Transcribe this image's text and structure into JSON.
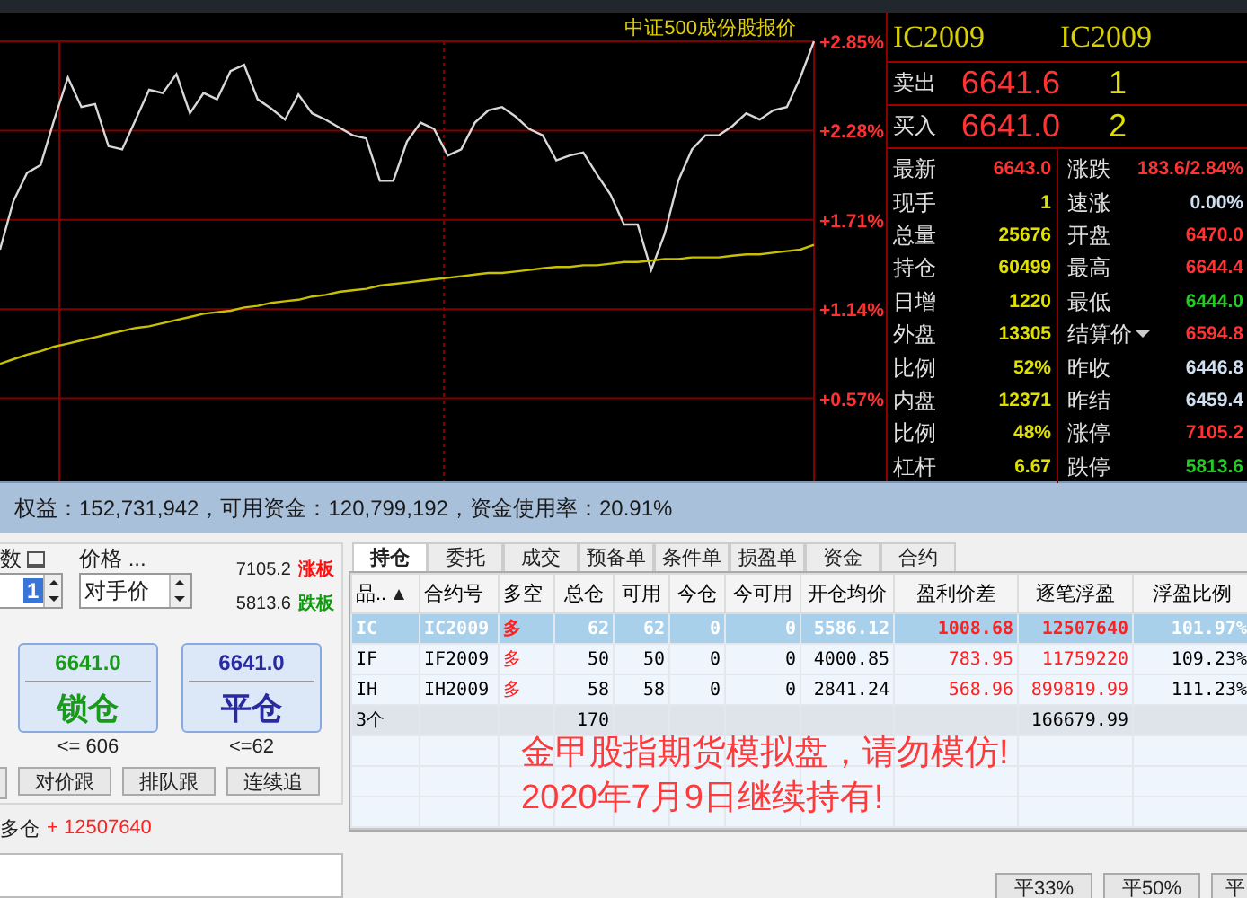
{
  "chart_panel": {
    "chart_data": {
      "type": "line",
      "title": "中证500成份股报价",
      "grid": true,
      "ylim": [
        0.04,
        2.85
      ],
      "yticks": [
        {
          "value": 0.57,
          "label": "+0.57%"
        },
        {
          "value": 1.14,
          "label": "+1.14%"
        },
        {
          "value": 1.71,
          "label": "+1.71%"
        },
        {
          "value": 2.28,
          "label": "+2.28%"
        },
        {
          "value": 2.85,
          "label": "+2.85%"
        }
      ],
      "series": [
        {
          "color": "#d8d8d8",
          "values": [
            1.52,
            1.83,
            2.01,
            2.06,
            2.35,
            2.62,
            2.43,
            2.45,
            2.18,
            2.16,
            2.35,
            2.54,
            2.52,
            2.64,
            2.39,
            2.52,
            2.48,
            2.66,
            2.7,
            2.48,
            2.42,
            2.35,
            2.51,
            2.39,
            2.35,
            2.3,
            2.25,
            2.23,
            1.96,
            1.96,
            2.21,
            2.33,
            2.29,
            2.12,
            2.16,
            2.33,
            2.41,
            2.43,
            2.37,
            2.29,
            2.25,
            2.09,
            2.12,
            2.14,
            2.0,
            1.87,
            1.68,
            1.68,
            1.39,
            1.62,
            1.96,
            2.16,
            2.25,
            2.25,
            2.31,
            2.39,
            2.35,
            2.41,
            2.43,
            2.62,
            2.85
          ]
        },
        {
          "color": "#c8c000",
          "values": [
            0.79,
            0.82,
            0.85,
            0.87,
            0.9,
            0.92,
            0.94,
            0.96,
            0.98,
            1.0,
            1.02,
            1.03,
            1.05,
            1.07,
            1.09,
            1.11,
            1.12,
            1.13,
            1.15,
            1.16,
            1.18,
            1.19,
            1.2,
            1.22,
            1.23,
            1.25,
            1.26,
            1.27,
            1.29,
            1.3,
            1.31,
            1.32,
            1.33,
            1.34,
            1.35,
            1.36,
            1.37,
            1.37,
            1.38,
            1.39,
            1.4,
            1.41,
            1.41,
            1.42,
            1.42,
            1.43,
            1.44,
            1.44,
            1.45,
            1.46,
            1.46,
            1.47,
            1.47,
            1.47,
            1.48,
            1.49,
            1.49,
            1.5,
            1.51,
            1.52,
            1.55
          ]
        }
      ]
    }
  },
  "quote": {
    "codes": [
      "IC2009",
      "IC2009"
    ],
    "book": [
      {
        "label": "卖出",
        "price": "6641.6",
        "volume": "1"
      },
      {
        "label": "买入",
        "price": "6641.0",
        "volume": "2"
      }
    ],
    "rows": [
      {
        "left": {
          "label": "最新",
          "value": "6643.0",
          "color": "#ff3333"
        },
        "right": {
          "label": "涨跌",
          "value": "183.6/2.84%",
          "color": "#ff3333",
          "kind": "plain"
        }
      },
      {
        "left": {
          "label": "现手",
          "value": "1",
          "color": "#e0e000"
        },
        "right": {
          "label": "速涨",
          "value": "0.00%",
          "color": "#d0e0f0",
          "kind": "plain"
        }
      },
      {
        "left": {
          "label": "总量",
          "value": "25676",
          "color": "#e0e000"
        },
        "right": {
          "label": "开盘",
          "value": "6470.0",
          "color": "#ff3333",
          "kind": "plain"
        }
      },
      {
        "left": {
          "label": "持仓",
          "value": "60499",
          "color": "#e0e000"
        },
        "right": {
          "label": "最高",
          "value": "6644.4",
          "color": "#ff3333",
          "kind": "plain"
        }
      },
      {
        "left": {
          "label": "日增",
          "value": "1220",
          "color": "#e0e000"
        },
        "right": {
          "label": "最低",
          "value": "6444.0",
          "color": "#22cc22",
          "kind": "plain"
        }
      },
      {
        "left": {
          "label": "外盘",
          "value": "13305",
          "color": "#e0e000"
        },
        "right": {
          "label": "结算价",
          "value": "6594.8",
          "color": "#ff3333",
          "kind": "menu"
        }
      },
      {
        "left": {
          "label": "比例",
          "value": "52%",
          "color": "#e0e000"
        },
        "right": {
          "label": "昨收",
          "value": "6446.8",
          "color": "#d0e0f0",
          "kind": "plain"
        }
      },
      {
        "left": {
          "label": "内盘",
          "value": "12371",
          "color": "#e0e000"
        },
        "right": {
          "label": "昨结",
          "value": "6459.4",
          "color": "#d0e0f0",
          "kind": "plain"
        }
      },
      {
        "left": {
          "label": "比例",
          "value": "48%",
          "color": "#e0e000"
        },
        "right": {
          "label": "涨停",
          "value": "7105.2",
          "color": "#ff3333",
          "kind": "plain"
        }
      },
      {
        "left": {
          "label": "杠杆",
          "value": "6.67",
          "color": "#e0e000"
        },
        "right": {
          "label": "跌停",
          "value": "5813.6",
          "color": "#22cc22",
          "kind": "plain"
        }
      }
    ]
  },
  "account_summary": "权益：152,731,942，可用资金：120,799,192，资金使用率：20.91%",
  "order_panel": {
    "quantity_label": "数",
    "quantity": "1",
    "price_label": "价格 ...",
    "price_type": "对手价",
    "limits": [
      {
        "value": "7105.2",
        "label": "涨板",
        "color": "#ff1010"
      },
      {
        "value": "5813.6",
        "label": "跌板",
        "color": "#109a10"
      }
    ],
    "actions": [
      {
        "price": "6641.0",
        "label": "锁仓",
        "limit": "<= 606",
        "color": "#1a9a1a"
      },
      {
        "price": "6641.0",
        "label": "平仓",
        "limit": "<=62",
        "color": "#2a2aa0"
      }
    ],
    "follow_buttons": [
      "对价跟",
      "排队跟",
      "连续追"
    ],
    "position_note": {
      "label": "多仓",
      "value": "+ 12507640"
    }
  },
  "tabs": [
    {
      "label": "持仓",
      "selected": true
    },
    {
      "label": "委托",
      "selected": false
    },
    {
      "label": "成交",
      "selected": false
    },
    {
      "label": "预备单",
      "selected": false
    },
    {
      "label": "条件单",
      "selected": false
    },
    {
      "label": "损盈单",
      "selected": false
    },
    {
      "label": "资金",
      "selected": false
    },
    {
      "label": "合约",
      "selected": false
    }
  ],
  "positions": {
    "columns": [
      {
        "label": "品..",
        "numeric": false,
        "sorted": true
      },
      {
        "label": "合约号",
        "numeric": false,
        "sorted": false
      },
      {
        "label": "多空",
        "numeric": false,
        "sorted": false
      },
      {
        "label": "总仓",
        "numeric": true,
        "sorted": false
      },
      {
        "label": "可用",
        "numeric": true,
        "sorted": false
      },
      {
        "label": "今仓",
        "numeric": true,
        "sorted": false
      },
      {
        "label": "今可用",
        "numeric": true,
        "sorted": false
      },
      {
        "label": "开仓均价",
        "numeric": true,
        "sorted": false
      },
      {
        "label": "盈利价差",
        "numeric": true,
        "sorted": false
      },
      {
        "label": "逐笔浮盈",
        "numeric": true,
        "sorted": false
      },
      {
        "label": "浮盈比例",
        "numeric": true,
        "sorted": false
      }
    ],
    "rows": [
      {
        "selected": true,
        "kind": "position",
        "cells": [
          {
            "text": "IC"
          },
          {
            "text": "IC2009"
          },
          {
            "text": "多",
            "color": "#ff2020"
          },
          {
            "text": "62"
          },
          {
            "text": "62"
          },
          {
            "text": "0"
          },
          {
            "text": "0"
          },
          {
            "text": "5586.12"
          },
          {
            "text": "1008.68",
            "color": "#ff2020"
          },
          {
            "text": "12507640",
            "color": "#ff2020"
          },
          {
            "text": "101.97%"
          }
        ]
      },
      {
        "selected": false,
        "kind": "position",
        "cells": [
          {
            "text": "IF"
          },
          {
            "text": "IF2009"
          },
          {
            "text": "多",
            "color": "#ff2020"
          },
          {
            "text": "50"
          },
          {
            "text": "50"
          },
          {
            "text": "0"
          },
          {
            "text": "0"
          },
          {
            "text": "4000.85"
          },
          {
            "text": "783.95",
            "color": "#ff2020"
          },
          {
            "text": "11759220",
            "color": "#ff2020"
          },
          {
            "text": "109.23%"
          }
        ]
      },
      {
        "selected": false,
        "kind": "position",
        "cells": [
          {
            "text": "IH"
          },
          {
            "text": "IH2009"
          },
          {
            "text": "多",
            "color": "#ff2020"
          },
          {
            "text": "58"
          },
          {
            "text": "58"
          },
          {
            "text": "0"
          },
          {
            "text": "0"
          },
          {
            "text": "2841.24"
          },
          {
            "text": "568.96",
            "color": "#ff2020"
          },
          {
            "text": "899819.99",
            "color": "#ff2020"
          },
          {
            "text": "111.23%"
          }
        ]
      },
      {
        "selected": false,
        "kind": "total",
        "cells": [
          {
            "text": "3个"
          },
          null,
          null,
          {
            "text": "170"
          },
          null,
          null,
          null,
          null,
          null,
          {
            "text": "166679.99"
          },
          null
        ]
      }
    ]
  },
  "annotation": [
    "金甲股指期货模拟盘，请勿模仿!",
    "2020年7月9日继续持有!"
  ],
  "close_buttons": [
    "平33%",
    "平50%",
    "平"
  ]
}
